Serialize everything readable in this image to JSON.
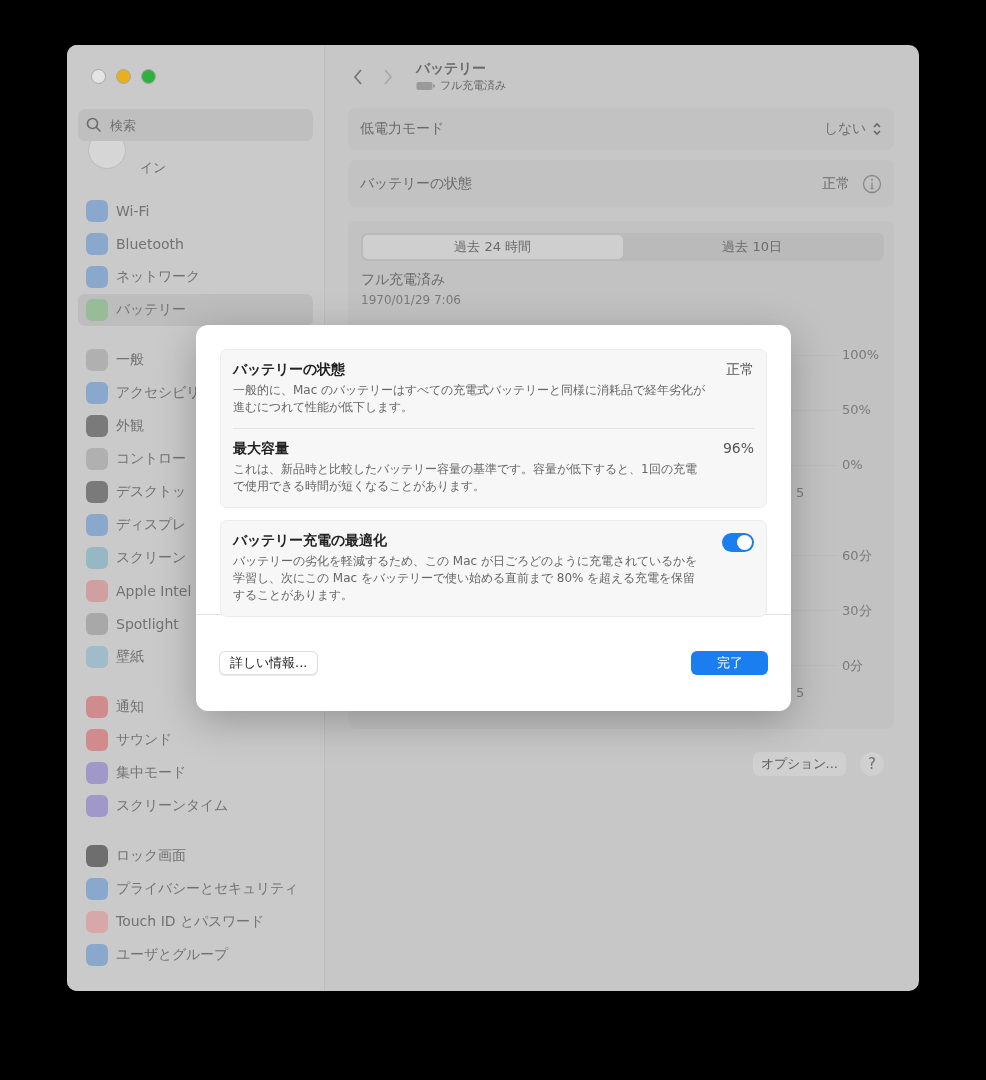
{
  "window": {
    "traffic_lights": [
      {
        "color": "#e4e4e4"
      },
      {
        "color": "#e8b020"
      },
      {
        "color": "#30b040"
      }
    ]
  },
  "sidebar": {
    "search": {
      "placeholder": "検索"
    },
    "account": {
      "label": "イン"
    },
    "groups": [
      [
        {
          "label": "Wi-Fi",
          "color": "#8aa8cc",
          "selected": false
        },
        {
          "label": "Bluetooth",
          "color": "#8aa8cc",
          "selected": false
        },
        {
          "label": "ネットワーク",
          "color": "#8aa8cc",
          "selected": false
        },
        {
          "label": "バッテリー",
          "color": "#98bc98",
          "selected": true
        }
      ],
      [
        {
          "label": "一般",
          "color": "#b0b0b0",
          "selected": false
        },
        {
          "label": "アクセシビリ",
          "color": "#8aa8cc",
          "selected": false
        },
        {
          "label": "外観",
          "color": "#7a7a7a",
          "selected": false
        },
        {
          "label": "コントロー",
          "color": "#b0b0b0",
          "selected": false
        },
        {
          "label": "デスクトッ",
          "color": "#7a7a7a",
          "selected": false
        },
        {
          "label": "ディスプレ",
          "color": "#8aa8cc",
          "selected": false
        },
        {
          "label": "スクリーン",
          "color": "#96b8c4",
          "selected": false
        },
        {
          "label": "Apple Intel",
          "color": "#d0a0a0",
          "selected": false
        },
        {
          "label": "Spotlight",
          "color": "#a8a8a8",
          "selected": false
        },
        {
          "label": "壁紙",
          "color": "#a0bcc8",
          "selected": false
        }
      ],
      [
        {
          "label": "通知",
          "color": "#d08c8c",
          "selected": false
        },
        {
          "label": "サウンド",
          "color": "#d08c8c",
          "selected": false
        },
        {
          "label": "集中モード",
          "color": "#a098c8",
          "selected": false
        },
        {
          "label": "スクリーンタイム",
          "color": "#a098c8",
          "selected": false
        }
      ],
      [
        {
          "label": "ロック画面",
          "color": "#6e6e6e",
          "selected": false
        },
        {
          "label": "プライバシーとセキュリティ",
          "color": "#8aa8cc",
          "selected": false
        },
        {
          "label": "Touch ID とパスワード",
          "color": "#d8a8a8",
          "selected": false
        },
        {
          "label": "ユーザとグループ",
          "color": "#8aa8cc",
          "selected": false
        }
      ]
    ]
  },
  "header": {
    "title": "バッテリー",
    "subtitle": "フル充電済み"
  },
  "settings": [
    {
      "kind": "popup",
      "label": "低電力モード",
      "value": "しない"
    },
    {
      "kind": "info",
      "label": "バッテリーの状態",
      "value": "正常"
    }
  ],
  "history": {
    "tabs": [
      {
        "label": "過去 24 時間",
        "selected": true
      },
      {
        "label": "過去 10日",
        "selected": false
      }
    ],
    "status": "フル充電済み",
    "date": "1970/01/29 7:06",
    "charts": [
      {
        "y_labels": [
          "100%",
          "50%",
          "0%"
        ],
        "x_label": "5"
      },
      {
        "y_labels": [
          "60分",
          "30分",
          "0分"
        ],
        "x_label": "5"
      }
    ]
  },
  "footer": {
    "options_button": "オプション...",
    "help_button": "?"
  },
  "dialog": {
    "sections": [
      [
        {
          "kind": "value",
          "title": "バッテリーの状態",
          "description": "一般的に、Mac のバッテリーはすべての充電式バッテリーと同様に消耗品で経年劣化が進むにつれて性能が低下します。",
          "value": "正常"
        },
        {
          "kind": "value",
          "title": "最大容量",
          "description": "これは、新品時と比較したバッテリー容量の基準です。容量が低下すると、1回の充電で使用できる時間が短くなることがあります。",
          "value": "96%"
        }
      ],
      [
        {
          "kind": "toggle",
          "title": "バッテリー充電の最適化",
          "description": "バッテリーの劣化を軽減するため、この Mac が日ごろどのように充電されているかを学習し、次にこの Mac をバッテリーで使い始める直前まで 80% を超える充電を保留することがあります。",
          "on": true
        }
      ]
    ],
    "more_button": "詳しい情報...",
    "done_button": "完了"
  }
}
